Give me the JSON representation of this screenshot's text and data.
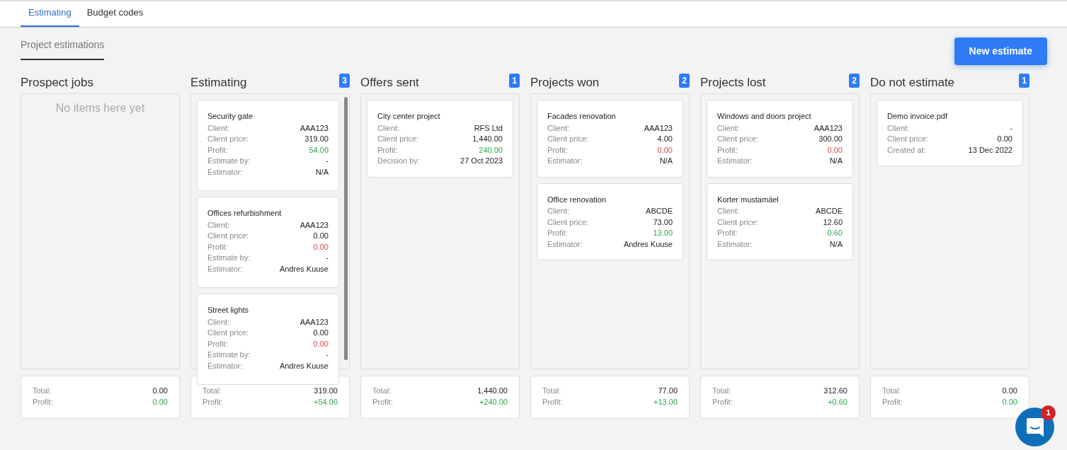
{
  "tabs": [
    {
      "label": "Estimating",
      "selected": true
    },
    {
      "label": "Budget codes",
      "selected": false
    }
  ],
  "page_title": "Project estimations",
  "new_button": "New estimate",
  "columns": [
    {
      "title": "Prospect jobs",
      "empty_text": "No items here yet",
      "totals": [
        {
          "label": "Total:",
          "value": "0.00"
        },
        {
          "label": "Profit:",
          "value": "0.00",
          "color": "#2eaa4f"
        }
      ]
    },
    {
      "title": "Estimating",
      "count": "3",
      "scrollable": true,
      "cards": [
        {
          "title": "Security gate",
          "fields": [
            {
              "label": "Client:",
              "value": "AAA123"
            },
            {
              "label": "Client price:",
              "value": "319.00"
            },
            {
              "label": "Profit:",
              "value": "54.00",
              "color": "#2eaa4f"
            },
            {
              "label": "Estimate by:",
              "value": "-"
            },
            {
              "label": "Estimator:",
              "value": "N/A"
            }
          ]
        },
        {
          "title": "Offices refurbishment",
          "fields": [
            {
              "label": "Client:",
              "value": "AAA123"
            },
            {
              "label": "Client price:",
              "value": "0.00"
            },
            {
              "label": "Profit:",
              "value": "0.00",
              "color": "#e0474c"
            },
            {
              "label": "Estimate by:",
              "value": "-"
            },
            {
              "label": "Estimator:",
              "value": "Andres Kuuse"
            }
          ]
        },
        {
          "title": "Street lights",
          "fields": [
            {
              "label": "Client:",
              "value": "AAA123"
            },
            {
              "label": "Client price:",
              "value": "0.00"
            },
            {
              "label": "Profit:",
              "value": "0.00",
              "color": "#e0474c"
            },
            {
              "label": "Estimate by:",
              "value": "-"
            },
            {
              "label": "Estimator:",
              "value": "Andres Kuuse"
            }
          ]
        }
      ],
      "totals": [
        {
          "label": "Total:",
          "value": "319.00"
        },
        {
          "label": "Profit:",
          "value": "+54.00",
          "color": "#2eaa4f"
        }
      ]
    },
    {
      "title": "Offers sent",
      "count": "1",
      "cards": [
        {
          "title": "City center project",
          "fields": [
            {
              "label": "Client:",
              "value": "RFS Ltd"
            },
            {
              "label": "Client price:",
              "value": "1,440.00"
            },
            {
              "label": "Profit:",
              "value": "240.00",
              "color": "#2eaa4f"
            },
            {
              "label": "Decision by:",
              "value": "27 Oct 2023"
            }
          ]
        }
      ],
      "totals": [
        {
          "label": "Total:",
          "value": "1,440.00"
        },
        {
          "label": "Profit:",
          "value": "+240.00",
          "color": "#2eaa4f"
        }
      ]
    },
    {
      "title": "Projects won",
      "count": "2",
      "cards": [
        {
          "title": "Facades renovation",
          "fields": [
            {
              "label": "Client:",
              "value": "AAA123"
            },
            {
              "label": "Client price:",
              "value": "4.00"
            },
            {
              "label": "Profit:",
              "value": "0.00",
              "color": "#e0474c"
            },
            {
              "label": "Estimator:",
              "value": "N/A"
            }
          ]
        },
        {
          "title": "Office renovation",
          "fields": [
            {
              "label": "Client:",
              "value": "ABCDE"
            },
            {
              "label": "Client price:",
              "value": "73.00"
            },
            {
              "label": "Profit:",
              "value": "13.00",
              "color": "#2eaa4f"
            },
            {
              "label": "Estimator:",
              "value": "Andres Kuuse"
            }
          ]
        }
      ],
      "totals": [
        {
          "label": "Total:",
          "value": "77.00"
        },
        {
          "label": "Profit:",
          "value": "+13.00",
          "color": "#2eaa4f"
        }
      ]
    },
    {
      "title": "Projects lost",
      "count": "2",
      "cards": [
        {
          "title": "Windows and doors project",
          "fields": [
            {
              "label": "Client:",
              "value": "AAA123"
            },
            {
              "label": "Client price:",
              "value": "300.00"
            },
            {
              "label": "Profit:",
              "value": "0.00",
              "color": "#e0474c"
            },
            {
              "label": "Estimator:",
              "value": "N/A"
            }
          ]
        },
        {
          "title": "Korter mustamäel",
          "fields": [
            {
              "label": "Client:",
              "value": "ABCDE"
            },
            {
              "label": "Client price:",
              "value": "12.60"
            },
            {
              "label": "Profit:",
              "value": "0.60",
              "color": "#2eaa4f"
            },
            {
              "label": "Estimator:",
              "value": "N/A"
            }
          ]
        }
      ],
      "totals": [
        {
          "label": "Total:",
          "value": "312.60"
        },
        {
          "label": "Profit:",
          "value": "+0.60",
          "color": "#2eaa4f"
        }
      ]
    },
    {
      "title": "Do not estimate",
      "count": "1",
      "cards": [
        {
          "title": "Demo invoice.pdf",
          "fields": [
            {
              "label": "Client:",
              "value": "-"
            },
            {
              "label": "Client price:",
              "value": "0.00"
            },
            {
              "label": "Created at:",
              "value": "13 Dec 2022"
            }
          ]
        }
      ],
      "totals": [
        {
          "label": "Total:",
          "value": "0.00"
        },
        {
          "label": "Profit:",
          "value": "0.00",
          "color": "#2eaa4f"
        }
      ]
    }
  ],
  "chat": {
    "badge": "1"
  }
}
